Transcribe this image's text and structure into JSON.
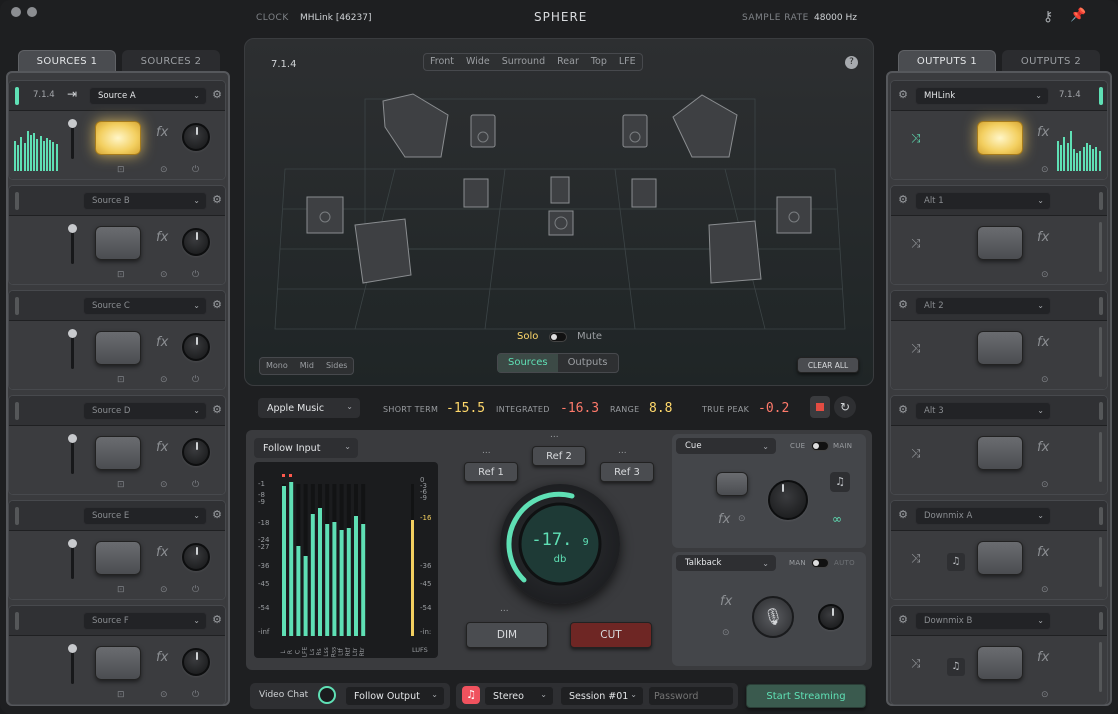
{
  "titlebar": {
    "clock_label": "CLOCK",
    "clock_value": "MHLink [46237]",
    "app_title": "SPHERE",
    "sample_rate_label": "SAMPLE RATE",
    "sample_rate_value": "48000 Hz"
  },
  "tabs": {
    "sources1": "SOURCES 1",
    "sources2": "SOURCES 2",
    "outputs1": "OUTPUTS 1",
    "outputs2": "OUTPUTS 2"
  },
  "sources": [
    {
      "format": "7.1.4",
      "name": "Source A",
      "active": true
    },
    {
      "name": "Source B"
    },
    {
      "name": "Source C"
    },
    {
      "name": "Source D"
    },
    {
      "name": "Source E"
    },
    {
      "name": "Source F"
    }
  ],
  "outputs": [
    {
      "name": "MHLink",
      "format": "7.1.4",
      "active": true
    },
    {
      "name": "Alt 1"
    },
    {
      "name": "Alt 2"
    },
    {
      "name": "Alt 3"
    },
    {
      "name": "Downmix A"
    },
    {
      "name": "Downmix B"
    }
  ],
  "fx_label": "fx",
  "stage": {
    "format": "7.1.4",
    "views": [
      "Front",
      "Wide",
      "Surround",
      "Rear",
      "Top",
      "LFE"
    ],
    "solo": "Solo",
    "mute": "Mute",
    "modes": [
      "Mono",
      "Mid",
      "Sides"
    ],
    "toggle": [
      "Sources",
      "Outputs"
    ],
    "clear": "CLEAR ALL",
    "help": "?"
  },
  "loudness": {
    "source": "Apple Music",
    "short_term_label": "SHORT TERM",
    "short_term": "-15.5",
    "integrated_label": "INTEGRATED",
    "integrated": "-16.3",
    "range_label": "RANGE",
    "range": "8.8",
    "true_peak_label": "TRUE PEAK",
    "true_peak": "-0.2"
  },
  "monitor": {
    "follow": "Follow Input",
    "refs": [
      "Ref 1",
      "Ref 2",
      "Ref 3"
    ],
    "ref_dots": "...",
    "volume": "-17.",
    "volume_dec": "9",
    "unit": "db",
    "dim": "DIM",
    "cut": "CUT",
    "left_scale": [
      "-1",
      "-8",
      "-9",
      "-18",
      "-24",
      "-27",
      "-36",
      "-45",
      "-54",
      "-inf"
    ],
    "right_scale": [
      "0",
      "-3",
      "-6",
      "-9",
      "-16",
      "-36",
      "-45",
      "-54",
      "-in:"
    ],
    "right_hi": "-16",
    "lufs": "LUFS",
    "channels": [
      "L",
      "R",
      "C",
      "LFE",
      "Ls",
      "Rs",
      "Lss",
      "Rss",
      "Ltf",
      "Rtf",
      "Ltr",
      "Rtr"
    ]
  },
  "cue": {
    "select": "Cue",
    "cue_label": "CUE",
    "main_label": "MAIN"
  },
  "talkback": {
    "select": "Talkback",
    "man_label": "MAN",
    "auto_label": "AUTO"
  },
  "bottom": {
    "video_chat": "Video Chat",
    "follow_output": "Follow Output",
    "stereo": "Stereo",
    "session": "Session #01",
    "password_placeholder": "Password",
    "stream": "Start Streaming"
  },
  "colors": {
    "accent": "#5fe0b5",
    "pad_lit": "#f3cf60",
    "integrated": "#ff7a6b",
    "range": "#ffd86b",
    "cut": "#7a2a28"
  }
}
